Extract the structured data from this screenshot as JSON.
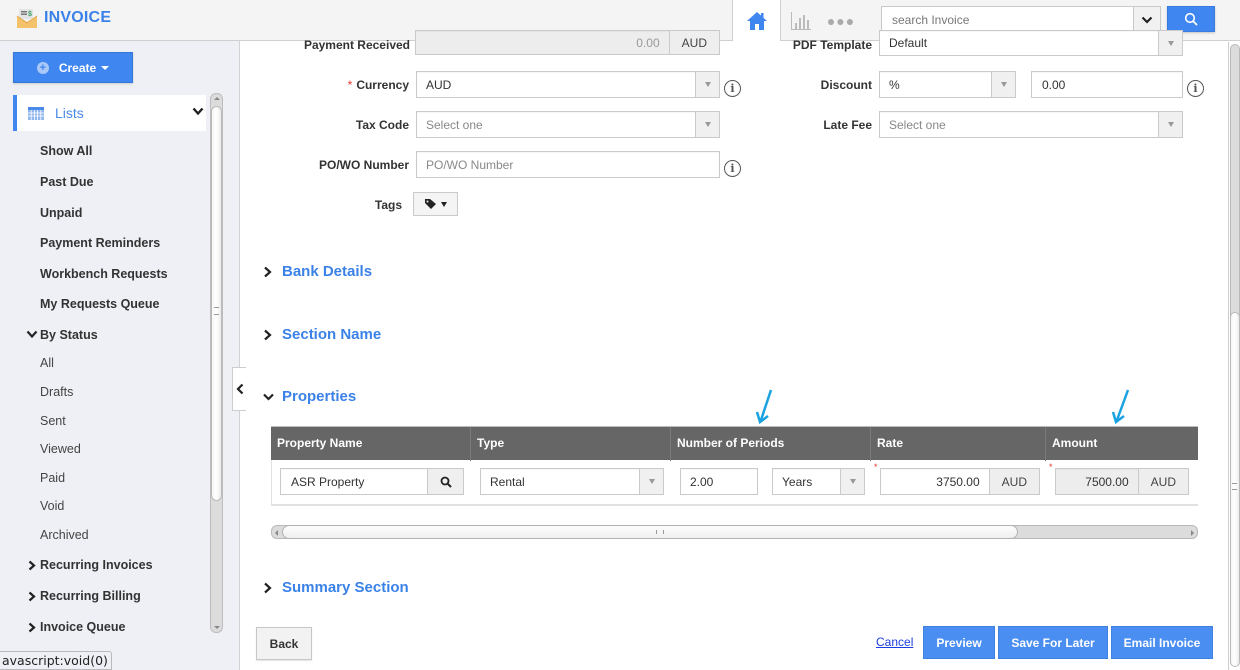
{
  "app": {
    "title": "INVOICE",
    "icon": "envelope-invoice-icon",
    "accent_color": "#3f86f0"
  },
  "header": {
    "nav_icons": [
      "home-icon",
      "bar-chart-icon",
      "more-dots-icon"
    ],
    "more_label": "●●●",
    "search": {
      "placeholder": "search Invoice",
      "value": ""
    }
  },
  "sidebar": {
    "create_label": "Create",
    "lists_label": "Lists",
    "items": [
      {
        "label": "Show All"
      },
      {
        "label": "Past Due"
      },
      {
        "label": "Unpaid"
      },
      {
        "label": "Payment Reminders"
      },
      {
        "label": "Workbench Requests"
      },
      {
        "label": "My Requests Queue"
      }
    ],
    "by_status": {
      "label": "By Status",
      "expanded": true,
      "items": [
        "All",
        "Drafts",
        "Sent",
        "Viewed",
        "Paid",
        "Void",
        "Archived"
      ]
    },
    "groups": [
      {
        "label": "Recurring Invoices",
        "expanded": false
      },
      {
        "label": "Recurring Billing",
        "expanded": false
      },
      {
        "label": "Invoice Queue",
        "expanded": false
      }
    ],
    "status_bar": "avascript:void(0)"
  },
  "form": {
    "left": {
      "payment_received": {
        "label": "Payment Received",
        "value": "0.00",
        "currency": "AUD"
      },
      "currency": {
        "label": "Currency",
        "required": "*",
        "value": "AUD"
      },
      "tax_code": {
        "label": "Tax Code",
        "placeholder": "Select one"
      },
      "po_wo_number": {
        "label": "PO/WO Number",
        "placeholder": "PO/WO Number",
        "value": ""
      },
      "tags": {
        "label": "Tags"
      }
    },
    "right": {
      "pdf_template": {
        "label": "PDF Template",
        "value": "Default"
      },
      "discount": {
        "label": "Discount",
        "type_value": "%",
        "value": "0.00"
      },
      "late_fee": {
        "label": "Late Fee",
        "placeholder": "Select one"
      }
    }
  },
  "sections": [
    {
      "title": "Bank Details",
      "expanded": false
    },
    {
      "title": "Section Name",
      "expanded": false
    },
    {
      "title": "Properties",
      "expanded": true
    },
    {
      "title": "Summary Section",
      "expanded": false
    }
  ],
  "properties_table": {
    "columns": [
      "Property Name",
      "Type",
      "Number of Periods",
      "Rate",
      "Amount"
    ],
    "rows": [
      {
        "property_name": "ASR Property",
        "type": "Rental",
        "periods": "2.00",
        "period_unit": "Years",
        "rate": "3750.00",
        "rate_currency": "AUD",
        "amount": "7500.00",
        "amount_currency": "AUD"
      }
    ],
    "required_mark": "*",
    "annotation_color": "#1aa3e0"
  },
  "footer": {
    "back_label": "Back",
    "cancel_label": "Cancel",
    "preview_label": "Preview",
    "save_later_label": "Save For Later",
    "email_label": "Email Invoice"
  }
}
